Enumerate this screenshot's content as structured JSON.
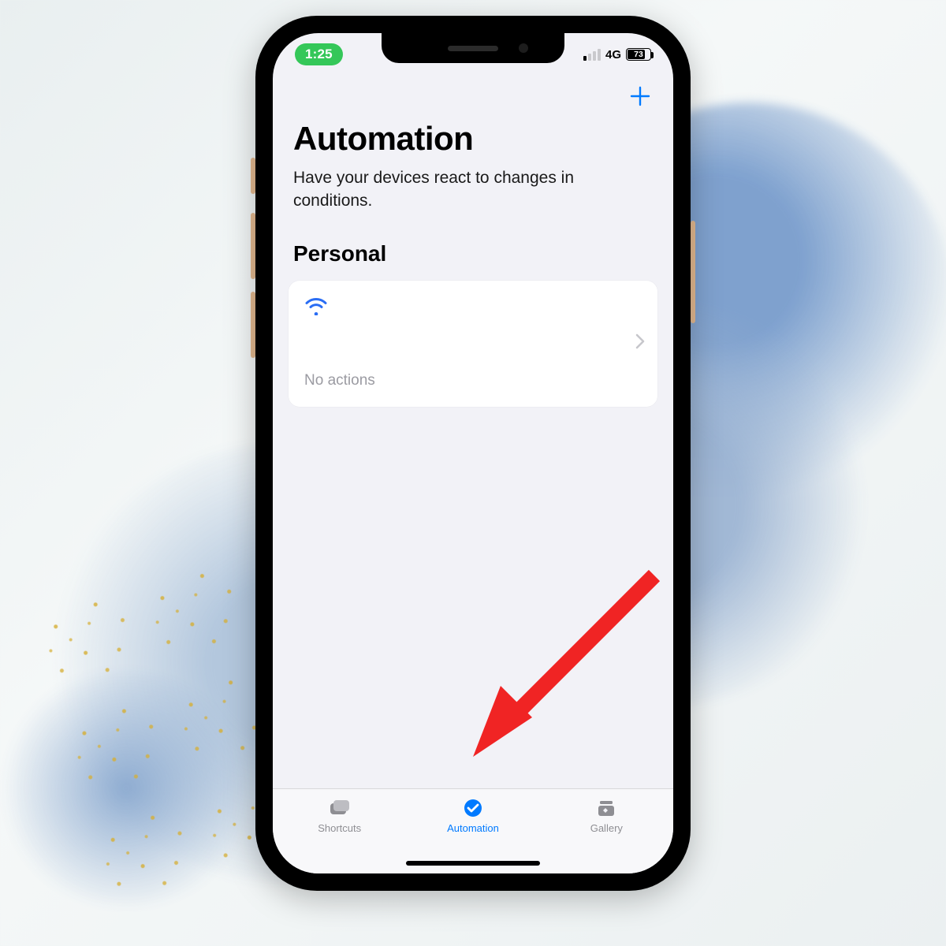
{
  "status": {
    "time": "1:25",
    "network_label": "4G",
    "battery_percent": "73"
  },
  "header": {
    "title": "Automation",
    "subtitle": "Have your devices react to changes in conditions."
  },
  "section": {
    "personal_label": "Personal"
  },
  "card": {
    "icon": "wifi",
    "subtitle": "No actions"
  },
  "tabs": {
    "shortcuts": "Shortcuts",
    "automation": "Automation",
    "gallery": "Gallery",
    "active": "automation"
  },
  "colors": {
    "accent": "#007aff",
    "inactive": "#8e8e93",
    "arrow": "#f02424"
  }
}
